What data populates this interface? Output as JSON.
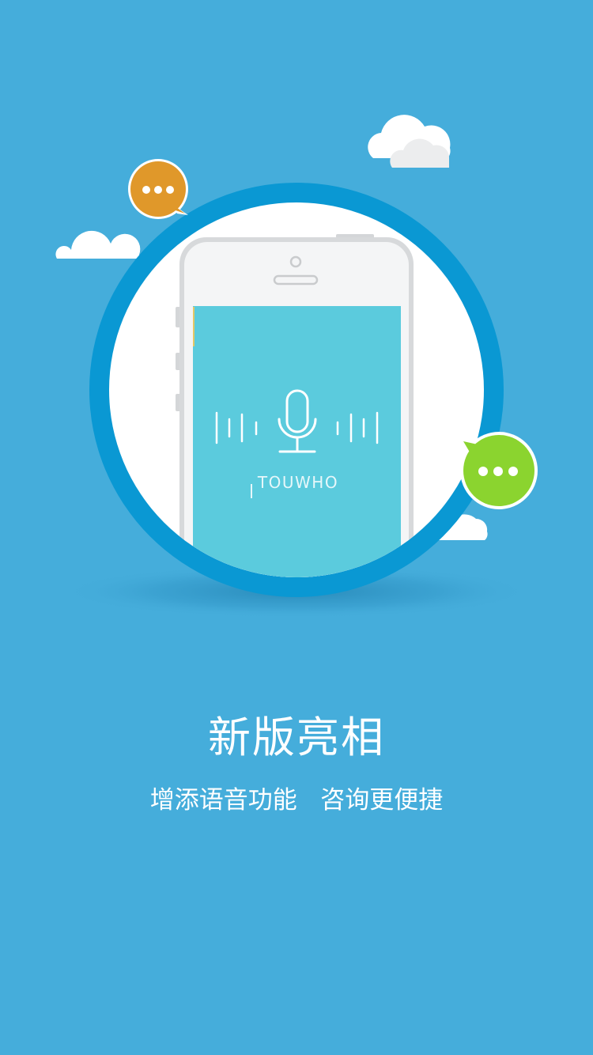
{
  "splash": {
    "brand": "TOUWHO",
    "headline": "新版亮相",
    "subline": "增添语音功能   咨询更便捷"
  },
  "icons": {
    "microphone": "microphone-icon",
    "chat_orange": "chat-bubble-orange-icon",
    "chat_green": "chat-bubble-green-icon",
    "cloud": "cloud-icon"
  },
  "colors": {
    "background": "#45ADDB",
    "ring": "#0A98D3",
    "screen": "#5BCBDD",
    "bubble_orange": "#E0982A",
    "bubble_green": "#8BD42F"
  }
}
